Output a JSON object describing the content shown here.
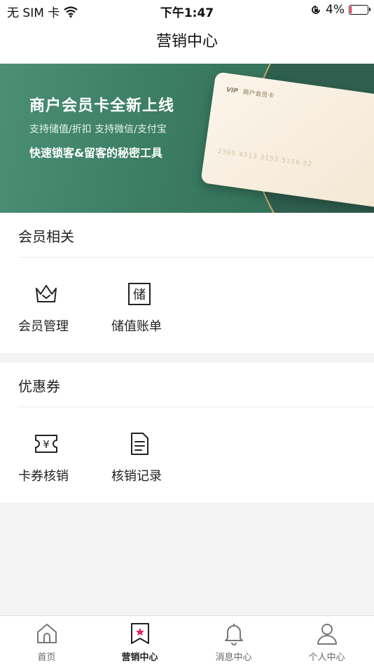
{
  "status_bar": {
    "carrier": "无 SIM 卡",
    "time": "下午1:47",
    "battery": "4%"
  },
  "nav": {
    "title": "营销中心"
  },
  "banner": {
    "headline": "商户会员卡全新上线",
    "subline": "支持储值/折扣  支持微信/支付宝",
    "tagline": "快速锁客&留客的秘密工具",
    "card_vip": "VIP",
    "card_label": "商户会员卡",
    "card_number": "2365 4513 3153 5156 32"
  },
  "sections": {
    "member": {
      "title": "会员相关",
      "items": [
        {
          "label": "会员管理",
          "icon": "crown-icon"
        },
        {
          "label": "储值账单",
          "icon": "stored-value-icon",
          "glyph": "储"
        }
      ]
    },
    "coupon": {
      "title": "优惠券",
      "items": [
        {
          "label": "卡券核销",
          "icon": "coupon-ticket-icon",
          "glyph": "¥"
        },
        {
          "label": "核销记录",
          "icon": "document-icon"
        }
      ]
    }
  },
  "tabs": [
    {
      "label": "首页",
      "icon": "home-icon",
      "active": false
    },
    {
      "label": "营销中心",
      "icon": "bookmark-star-icon",
      "active": true
    },
    {
      "label": "消息中心",
      "icon": "bell-icon",
      "active": false
    },
    {
      "label": "个人中心",
      "icon": "person-icon",
      "active": false
    }
  ],
  "colors": {
    "banner_green": "#3b7c63",
    "accent_red": "#e0245e",
    "tab_active": "#222222"
  }
}
